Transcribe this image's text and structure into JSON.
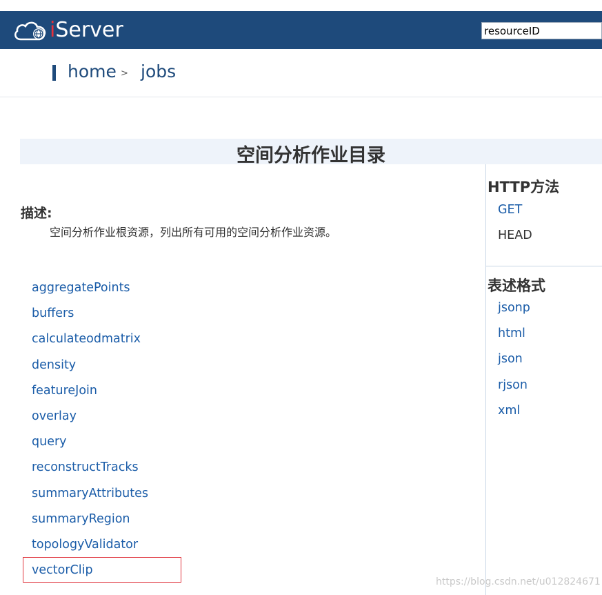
{
  "header": {
    "logo_text": "Server",
    "logo_i": "i",
    "search_value": "resourceID",
    "colors": {
      "header_bg": "#1e4a7b",
      "logo_i": "#e8303a"
    }
  },
  "breadcrumb": {
    "home": "home",
    "separator": ">",
    "current": "jobs"
  },
  "page": {
    "title": "空间分析作业目录",
    "description_label": "描述:",
    "description_text": "空间分析作业根资源，列出所有可用的空间分析作业资源。"
  },
  "resources": [
    "aggregatePoints",
    "buffers",
    "calculateodmatrix",
    "density",
    "featureJoin",
    "overlay",
    "query",
    "reconstructTracks",
    "summaryAttributes",
    "summaryRegion",
    "topologyValidator",
    "vectorClip"
  ],
  "sidebar": {
    "http_heading": "HTTP方法",
    "http_methods": [
      "GET",
      "HEAD"
    ],
    "format_heading": "表述格式",
    "formats": [
      "jsonp",
      "html",
      "json",
      "rjson",
      "xml"
    ]
  },
  "watermark": "https://blog.csdn.net/u012824671"
}
